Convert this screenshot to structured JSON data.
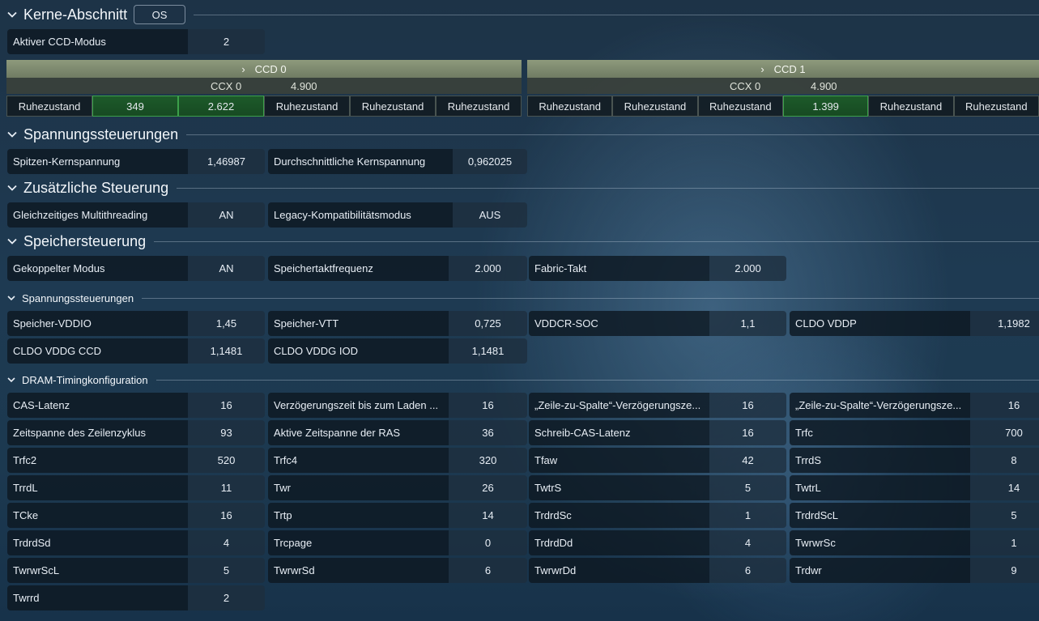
{
  "kerne": {
    "title": "Kerne-Abschnitt",
    "badge": "OS",
    "ccd_mode_label": "Aktiver CCD-Modus",
    "ccd_mode_value": "2"
  },
  "ccds": [
    {
      "header": "CCD 0",
      "ccx": "CCX 0",
      "freq": "4.900",
      "cores": [
        {
          "text": "Ruhezustand",
          "active": false
        },
        {
          "text": "349",
          "active": true
        },
        {
          "text": "2.622",
          "active": true
        },
        {
          "text": "Ruhezustand",
          "active": false
        },
        {
          "text": "Ruhezustand",
          "active": false
        },
        {
          "text": "Ruhezustand",
          "active": false
        }
      ]
    },
    {
      "header": "CCD 1",
      "ccx": "CCX 0",
      "freq": "4.900",
      "cores": [
        {
          "text": "Ruhezustand",
          "active": false
        },
        {
          "text": "Ruhezustand",
          "active": false
        },
        {
          "text": "Ruhezustand",
          "active": false
        },
        {
          "text": "1.399",
          "active": true
        },
        {
          "text": "Ruhezustand",
          "active": false
        },
        {
          "text": "Ruhezustand",
          "active": false
        }
      ]
    }
  ],
  "spannung": {
    "title": "Spannungssteuerungen",
    "items": [
      {
        "label": "Spitzen-Kernspannung",
        "value": "1,46987"
      },
      {
        "label": "Durchschnittliche Kernspannung",
        "value": "0,962025"
      }
    ]
  },
  "zusatz": {
    "title": "Zusätzliche Steuerung",
    "items": [
      {
        "label": "Gleichzeitiges Multithreading",
        "value": "AN"
      },
      {
        "label": "Legacy-Kompatibilitätsmodus",
        "value": "AUS"
      }
    ]
  },
  "speicher": {
    "title": "Speichersteuerung",
    "items": [
      {
        "label": "Gekoppelter Modus",
        "value": "AN"
      },
      {
        "label": "Speichertaktfrequenz",
        "value": "2.000"
      },
      {
        "label": "Fabric-Takt",
        "value": "2.000"
      }
    ]
  },
  "mem_volt": {
    "title": "Spannungssteuerungen",
    "items": [
      {
        "label": "Speicher-VDDIO",
        "value": "1,45"
      },
      {
        "label": "Speicher-VTT",
        "value": "0,725"
      },
      {
        "label": "VDDCR-SOC",
        "value": "1,1"
      },
      {
        "label": "CLDO VDDP",
        "value": "1,1982"
      },
      {
        "label": "CLDO VDDG CCD",
        "value": "1,1481"
      },
      {
        "label": "CLDO VDDG IOD",
        "value": "1,1481"
      }
    ]
  },
  "dram": {
    "title": "DRAM-Timingkonfiguration",
    "items": [
      {
        "label": "CAS-Latenz",
        "value": "16"
      },
      {
        "label": "Verzögerungszeit bis zum Laden ...",
        "value": "16"
      },
      {
        "label": "„Zeile-zu-Spalte“-Verzögerungsze...",
        "value": "16"
      },
      {
        "label": "„Zeile-zu-Spalte“-Verzögerungsze...",
        "value": "16"
      },
      {
        "label": "Zeitspanne des Zeilenzyklus",
        "value": "93"
      },
      {
        "label": "Aktive Zeitspanne der RAS",
        "value": "36"
      },
      {
        "label": "Schreib-CAS-Latenz",
        "value": "16"
      },
      {
        "label": "Trfc",
        "value": "700"
      },
      {
        "label": "Trfc2",
        "value": "520"
      },
      {
        "label": "Trfc4",
        "value": "320"
      },
      {
        "label": "Tfaw",
        "value": "42"
      },
      {
        "label": "TrrdS",
        "value": "8"
      },
      {
        "label": "TrrdL",
        "value": "11"
      },
      {
        "label": "Twr",
        "value": "26"
      },
      {
        "label": "TwtrS",
        "value": "5"
      },
      {
        "label": "TwtrL",
        "value": "14"
      },
      {
        "label": "TCke",
        "value": "16"
      },
      {
        "label": "Trtp",
        "value": "14"
      },
      {
        "label": "TrdrdSc",
        "value": "1"
      },
      {
        "label": "TrdrdScL",
        "value": "5"
      },
      {
        "label": "TrdrdSd",
        "value": "4"
      },
      {
        "label": "Trcpage",
        "value": "0"
      },
      {
        "label": "TrdrdDd",
        "value": "4"
      },
      {
        "label": "TwrwrSc",
        "value": "1"
      },
      {
        "label": "TwrwrScL",
        "value": "5"
      },
      {
        "label": "TwrwrSd",
        "value": "6"
      },
      {
        "label": "TwrwrDd",
        "value": "6"
      },
      {
        "label": "Trdwr",
        "value": "9"
      },
      {
        "label": "Twrrd",
        "value": "2"
      }
    ]
  }
}
